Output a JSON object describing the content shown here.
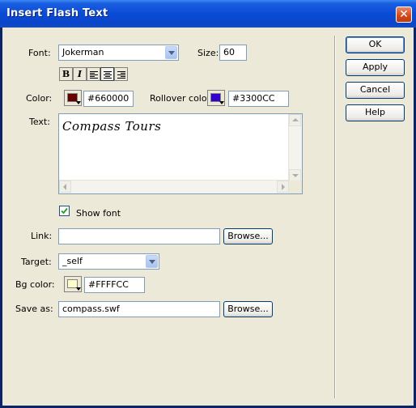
{
  "window": {
    "title": "Insert Flash Text",
    "close_glyph": "✕"
  },
  "font": {
    "label": "Font:",
    "value": "Jokerman"
  },
  "size": {
    "label": "Size:",
    "value": "60"
  },
  "format": {
    "bold_label": "B",
    "italic_label": "I",
    "icons": [
      "align-left-icon",
      "align-center-icon",
      "align-right-icon"
    ]
  },
  "color": {
    "label": "Color:",
    "value": "#660000",
    "swatch": "#660000"
  },
  "rollover": {
    "label": "Rollover color:",
    "value": "#3300CC",
    "swatch": "#3300CC"
  },
  "text": {
    "label": "Text:",
    "value": "Compass Tours"
  },
  "show_font": {
    "label": "Show font",
    "checked": true
  },
  "link": {
    "label": "Link:",
    "value": "",
    "browse_label": "Browse..."
  },
  "target": {
    "label": "Target:",
    "value": "_self"
  },
  "bg_color": {
    "label": "Bg color:",
    "value": "#FFFFCC",
    "swatch": "#FFFFCC"
  },
  "save_as": {
    "label": "Save as:",
    "value": "compass.swf",
    "browse_label": "Browse..."
  },
  "buttons": {
    "ok": "OK",
    "apply": "Apply",
    "cancel": "Cancel",
    "help": "Help"
  }
}
